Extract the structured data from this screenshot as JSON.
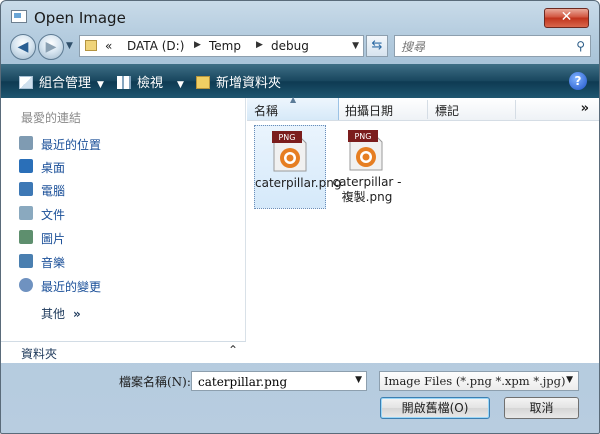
{
  "window": {
    "title": "Open Image",
    "close_glyph": "✕"
  },
  "nav": {
    "back_glyph": "◀",
    "forward_glyph": "▶",
    "breadcrumb_prefix": "«",
    "path": [
      "DATA (D:)",
      "Temp",
      "debug"
    ],
    "search_placeholder": "搜尋"
  },
  "toolbar": {
    "organize": "組合管理",
    "views": "檢視",
    "new_folder": "新增資料夾",
    "help": "?"
  },
  "sidebar": {
    "favorites_header": "最愛的連結",
    "items": [
      {
        "label": "最近的位置",
        "icon": "recent-places-icon",
        "color": "#7f9bb2"
      },
      {
        "label": "桌面",
        "icon": "desktop-icon",
        "color": "#2a6fb8"
      },
      {
        "label": "電腦",
        "icon": "computer-icon",
        "color": "#3d78b5"
      },
      {
        "label": "文件",
        "icon": "documents-icon",
        "color": "#8aa9bf"
      },
      {
        "label": "圖片",
        "icon": "pictures-icon",
        "color": "#5e8f6e"
      },
      {
        "label": "音樂",
        "icon": "music-icon",
        "color": "#4a7fb0"
      },
      {
        "label": "最近的變更",
        "icon": "recent-changes-icon",
        "color": "#6f92c0"
      }
    ],
    "more": "其他",
    "more_chevron": "»",
    "folders": "資料夾"
  },
  "columns": [
    "名稱",
    "拍攝日期",
    "標記"
  ],
  "files": [
    {
      "name": "caterpillar.png",
      "badge": "PNG",
      "selected": true
    },
    {
      "name": "caterpillar - 複製.png",
      "badge": "PNG",
      "selected": false
    }
  ],
  "footer": {
    "filename_label": "檔案名稱(N):",
    "filename_value": "caterpillar.png",
    "filter": "Image Files (*.png *.xpm *.jpg)",
    "open_button": "開啟舊檔(O)",
    "cancel_button": "取消"
  }
}
